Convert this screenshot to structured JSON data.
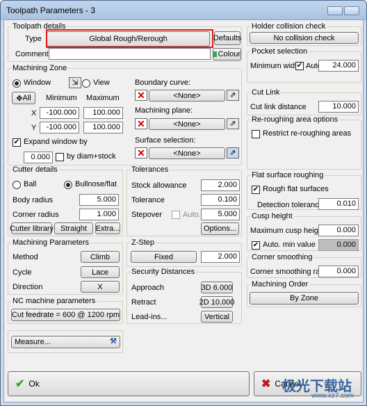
{
  "window": {
    "title": "Toolpath Parameters - 3"
  },
  "toolpath_details": {
    "legend": "Toolpath details",
    "type_label": "Type",
    "type_value": "Global Rough/Rerough",
    "defaults_label": "Defaults",
    "comment_label": "Comment",
    "comment_value": "",
    "colour_label": "Colour",
    "colour_swatch": "#22b14c"
  },
  "holder": {
    "legend": "Holder collision check",
    "button": "No collision check"
  },
  "pocket": {
    "legend": "Pocket selection",
    "min_width_label": "Minimum width",
    "auto_label": "Auto",
    "auto_checked": true,
    "value": "24.000"
  },
  "cut_link": {
    "legend": "Cut Link",
    "label": "Cut link distance",
    "value": "10.000"
  },
  "reroughing": {
    "legend": "Re-roughing area options",
    "restrict_label": "Restrict re-roughing areas",
    "checked": false
  },
  "flat_surface": {
    "legend": "Flat surface roughing",
    "rough_label": "Rough flat surfaces",
    "rough_checked": true,
    "detection_label": "Detection tolerance",
    "detection_value": "0.010"
  },
  "cusp": {
    "legend": "Cusp height",
    "max_label": "Maximum cusp height",
    "max_value": "0.000",
    "auto_label": "Auto. min value",
    "auto_checked": true,
    "auto_value": "0.000"
  },
  "corner": {
    "legend": "Corner smoothing",
    "label": "Corner smoothing radius",
    "value": "0.000"
  },
  "machining_order": {
    "legend": "Machining Order",
    "button": "By Zone"
  },
  "machining_zone": {
    "legend": "Machining Zone",
    "window_label": "Window",
    "view_label": "View",
    "all_label": "All",
    "minimum_label": "Minimum",
    "maximum_label": "Maximum",
    "x_label": "X",
    "x_min": "-100.000",
    "x_max": "100.000",
    "y_label": "Y",
    "y_min": "-100.000",
    "y_max": "100.000",
    "expand_label": "Expand window by",
    "expand_checked": true,
    "expand_value": "0.000",
    "diam_label": "by diam+stock",
    "diam_checked": false,
    "boundary_label": "Boundary curve:",
    "boundary_value": "<None>",
    "plane_label": "Machining plane:",
    "plane_value": "<None>",
    "surface_label": "Surface selection:",
    "surface_value": "<None>"
  },
  "cutter": {
    "legend": "Cutter details",
    "ball_label": "Ball",
    "bullnose_label": "Bullnose/flat",
    "body_radius_label": "Body radius",
    "body_radius": "5.000",
    "corner_radius_label": "Corner radius",
    "corner_radius": "1.000",
    "library_button": "Cutter library",
    "straight_button": "Straight",
    "extra_button": "Extra..."
  },
  "tolerances": {
    "legend": "Tolerances",
    "stock_label": "Stock allowance",
    "stock_value": "2.000",
    "tol_label": "Tolerance",
    "tol_value": "0.100",
    "stepover_label": "Stepover",
    "stepover_auto_label": "Auto.",
    "stepover_value": "5.000",
    "options_button": "Options..."
  },
  "machining_params": {
    "legend": "Machining Parameters",
    "method_label": "Method",
    "method_value": "Climb",
    "cycle_label": "Cycle",
    "cycle_value": "Lace",
    "direction_label": "Direction",
    "direction_value": "X"
  },
  "zstep": {
    "legend": "Z-Step",
    "mode": "Fixed",
    "value": "2.000"
  },
  "nc": {
    "legend": "NC machine parameters",
    "button": "Cut feedrate = 600 @ 1200 rpm"
  },
  "security": {
    "legend": "Security Distances",
    "approach_label": "Approach",
    "approach_value": "3D 6.000",
    "retract_label": "Retract",
    "retract_value": "2D 10.000",
    "leadins_label": "Lead-ins...",
    "leadins_value": "Vertical"
  },
  "measure": {
    "label": "Measure..."
  },
  "footer": {
    "ok_label": "Ok",
    "cancel_label": "Cancel"
  },
  "watermark": {
    "text_cn": "极光下载站",
    "url": "www.xz7.com"
  }
}
